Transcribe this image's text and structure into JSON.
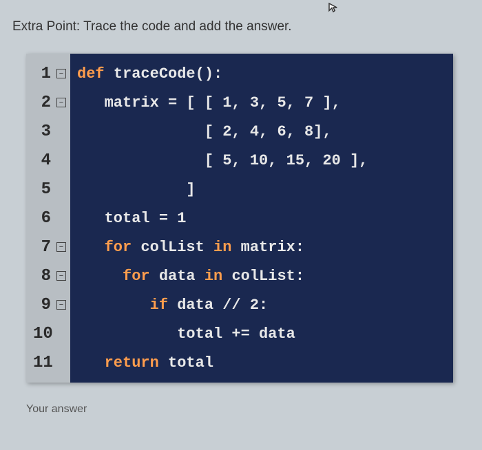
{
  "question": "Extra Point: Trace the code and add the answer.",
  "answer_label": "Your answer",
  "cursor_glyph": "↖",
  "fold_glyph": "⊟",
  "code": {
    "lines": [
      {
        "num": "1",
        "fold": true,
        "tokens": [
          {
            "c": "kw",
            "t": "def "
          },
          {
            "c": "def",
            "t": "traceCode():"
          }
        ]
      },
      {
        "num": "2",
        "fold": true,
        "tokens": [
          {
            "c": "def",
            "t": "   matrix = [ [ 1, 3, 5, 7 ],"
          }
        ]
      },
      {
        "num": "3",
        "fold": false,
        "tokens": [
          {
            "c": "def",
            "t": "              [ 2, 4, 6, 8],"
          }
        ]
      },
      {
        "num": "4",
        "fold": false,
        "tokens": [
          {
            "c": "def",
            "t": "              [ 5, 10, 15, 20 ],"
          }
        ]
      },
      {
        "num": "5",
        "fold": false,
        "tokens": [
          {
            "c": "def",
            "t": "            ]"
          }
        ]
      },
      {
        "num": "6",
        "fold": false,
        "tokens": [
          {
            "c": "def",
            "t": "   total = 1"
          }
        ]
      },
      {
        "num": "7",
        "fold": true,
        "tokens": [
          {
            "c": "def",
            "t": "   "
          },
          {
            "c": "kw",
            "t": "for"
          },
          {
            "c": "def",
            "t": " colList "
          },
          {
            "c": "kw",
            "t": "in"
          },
          {
            "c": "def",
            "t": " matrix:"
          }
        ]
      },
      {
        "num": "8",
        "fold": true,
        "tokens": [
          {
            "c": "def",
            "t": "     "
          },
          {
            "c": "kw",
            "t": "for"
          },
          {
            "c": "def",
            "t": " data "
          },
          {
            "c": "kw",
            "t": "in"
          },
          {
            "c": "def",
            "t": " colList:"
          }
        ]
      },
      {
        "num": "9",
        "fold": true,
        "tokens": [
          {
            "c": "def",
            "t": "        "
          },
          {
            "c": "kw",
            "t": "if"
          },
          {
            "c": "def",
            "t": " data // 2:"
          }
        ]
      },
      {
        "num": "10",
        "fold": false,
        "tokens": [
          {
            "c": "def",
            "t": "           total += data"
          }
        ]
      },
      {
        "num": "11",
        "fold": false,
        "tokens": [
          {
            "c": "def",
            "t": "   "
          },
          {
            "c": "kw",
            "t": "return"
          },
          {
            "c": "def",
            "t": " total"
          }
        ]
      }
    ]
  }
}
